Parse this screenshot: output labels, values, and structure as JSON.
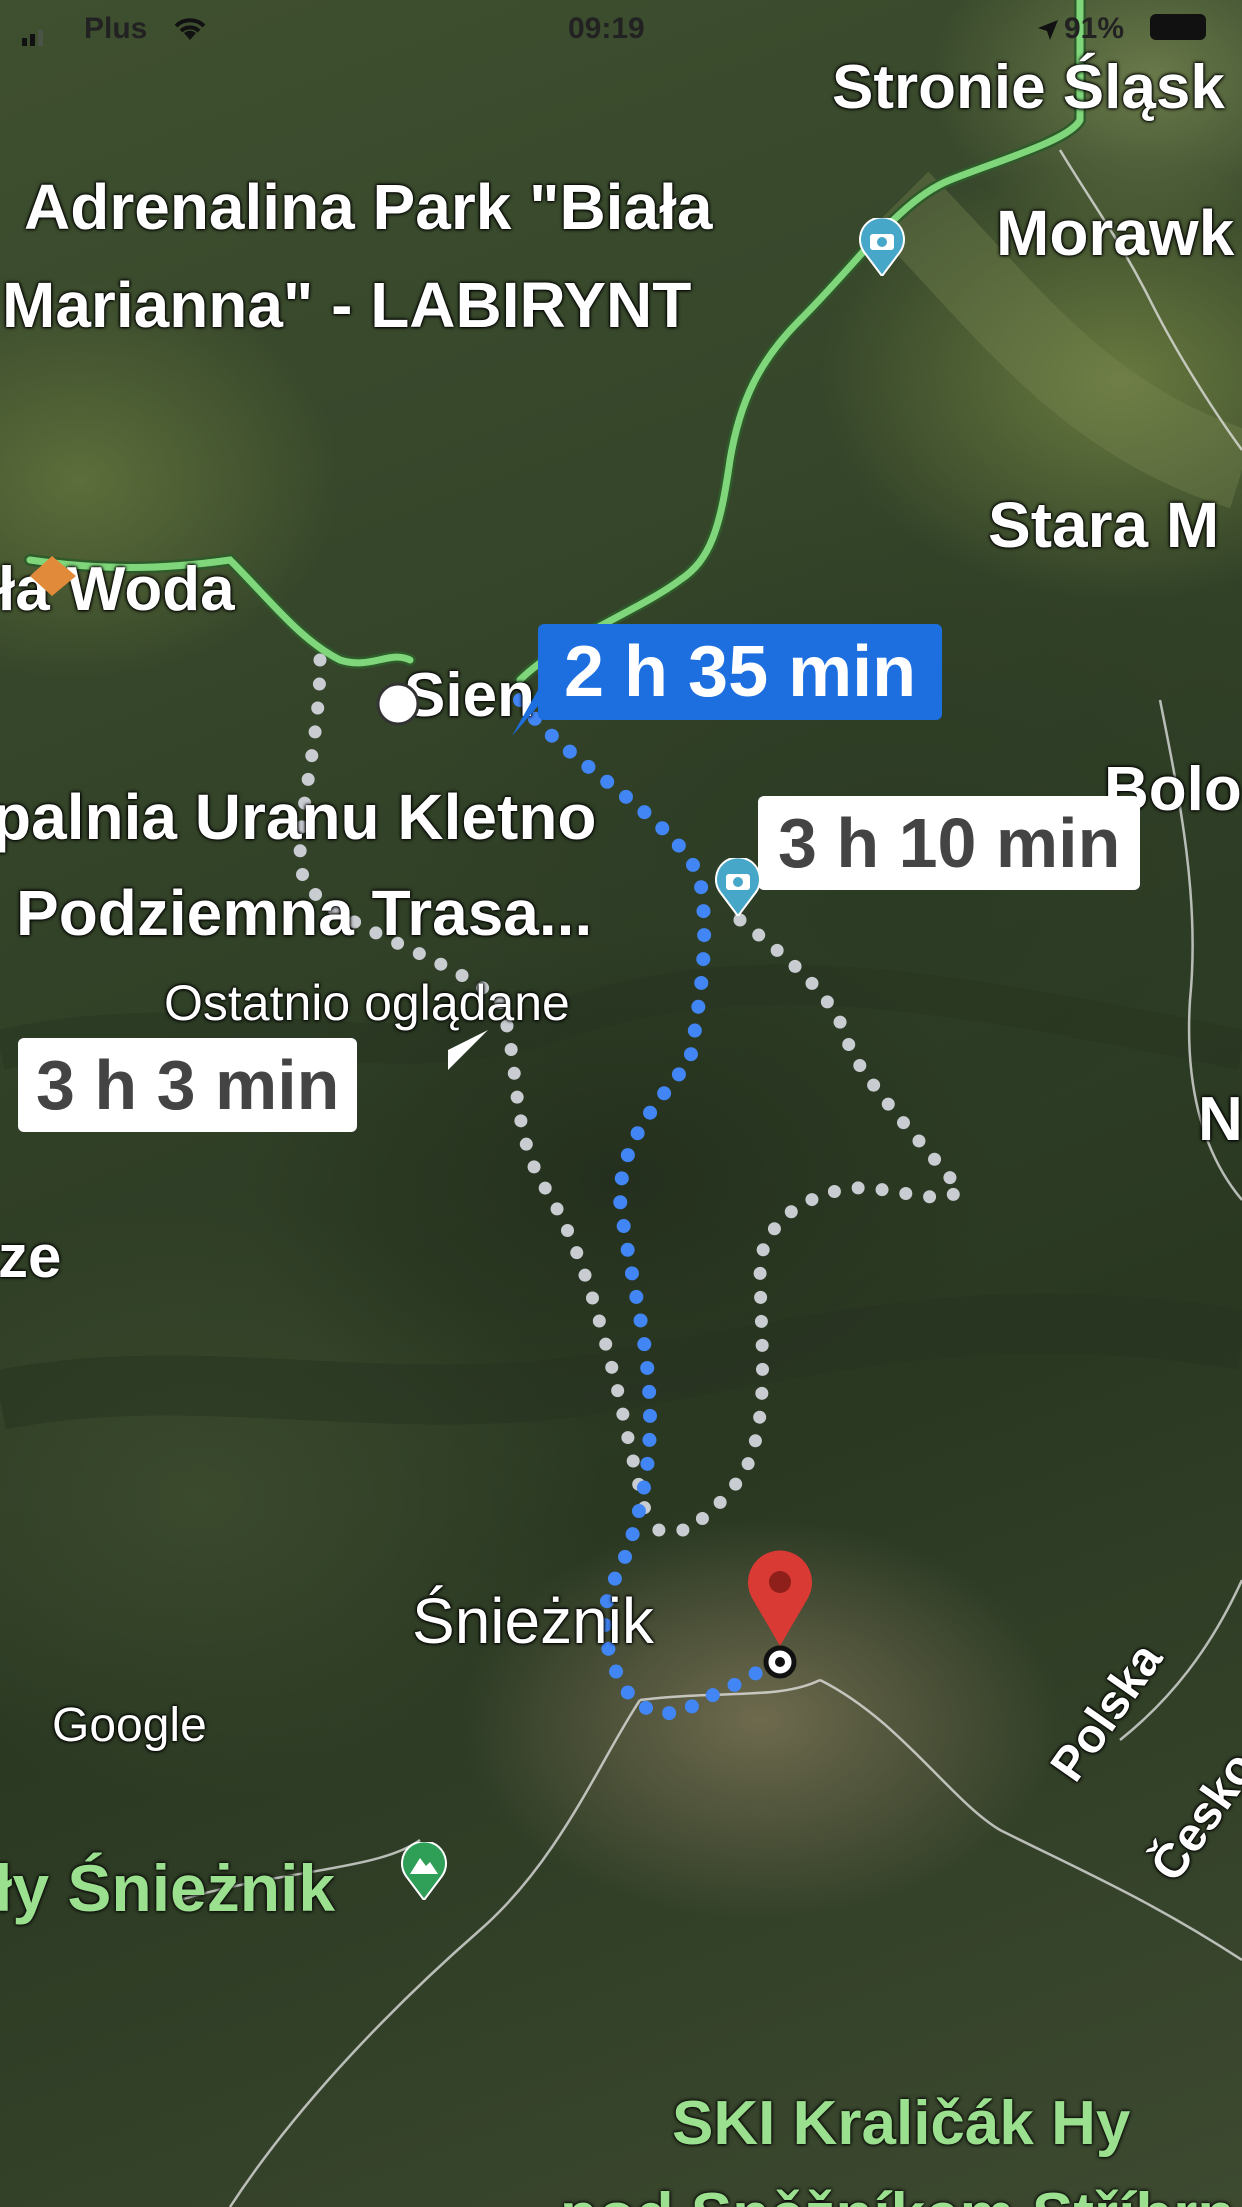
{
  "status_bar": {
    "carrier": "Plus",
    "time": "09:19",
    "battery": "91%"
  },
  "places": {
    "stronie": "Stronie Śląsk",
    "adrenalina_line1": "Adrenalina Park \"Biała",
    "adrenalina_line2": "Marianna\" - LABIRYNT",
    "morawka": "Morawk",
    "stara": "Stara M",
    "biala_woda": "ła Woda",
    "sienna": "Sien",
    "kopalnia_line1": "palnia Uranu Kletno",
    "kopalnia_line2": "Podziemna Trasa...",
    "recent": "Ostatnio oglądane",
    "bolo": "Bolo",
    "n_edge": "N",
    "ze": "ze",
    "sniez": "Śnieżnik",
    "google": "Google",
    "sniezy_green": "ły Śnieżnik",
    "polska": "Polska",
    "cesko": "Česko",
    "ski_line1": "SKI Kraličák Hy",
    "ski_line2": "pod Sněžníkem Stříbrn"
  },
  "routes": {
    "primary": "2 h 35 min",
    "alt1": "3 h 10 min",
    "alt2": "3 h 3 min"
  },
  "icons": {
    "signal": "signal-icon",
    "wifi": "wifi-icon",
    "location": "location-arrow-icon",
    "battery": "battery-icon",
    "camera_poi": "camera-pin-icon",
    "mountain_poi": "mountain-pin-icon",
    "destination": "destination-pin-icon",
    "start": "start-dot-icon"
  },
  "colors": {
    "route_primary": "#4285f4",
    "route_alt": "#c9cdd2",
    "highway": "#7fd67b",
    "badge_blue": "#1d6fe0",
    "destination_pin": "#d93a34",
    "poi_blue": "#47a7c9",
    "poi_green": "#2f9e56"
  }
}
